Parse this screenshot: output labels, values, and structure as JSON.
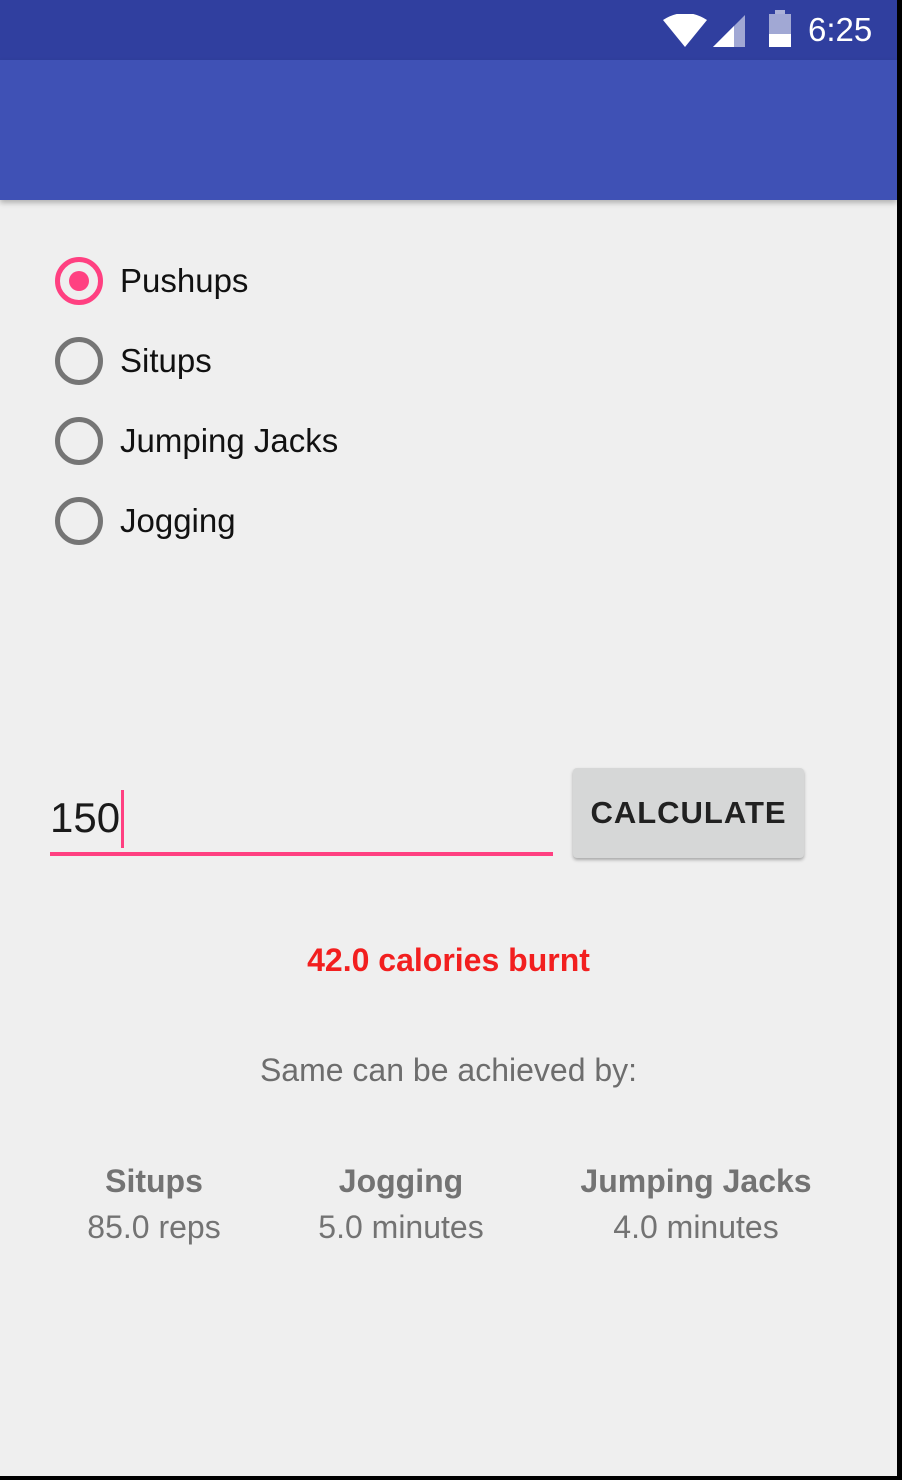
{
  "status_bar": {
    "time": "6:25",
    "icons": [
      "wifi-icon",
      "signal-icon",
      "battery-icon"
    ]
  },
  "colors": {
    "status_bar": "#303f9f",
    "app_bar": "#3f51b5",
    "accent": "#ff4081",
    "background": "#efefef",
    "result": "#f21f1f"
  },
  "exercises": {
    "selected": "Pushups",
    "options": [
      {
        "label": "Pushups",
        "checked": true
      },
      {
        "label": "Situps",
        "checked": false
      },
      {
        "label": "Jumping Jacks",
        "checked": false
      },
      {
        "label": "Jogging",
        "checked": false
      }
    ]
  },
  "input": {
    "value": "150"
  },
  "calculate_button": {
    "label": "CALCULATE"
  },
  "result": {
    "text": "42.0 calories burnt"
  },
  "equivalents": {
    "heading": "Same can be achieved by:",
    "items": [
      {
        "name": "Situps",
        "amount": "85.0 reps"
      },
      {
        "name": "Jogging",
        "amount": "5.0 minutes"
      },
      {
        "name": "Jumping Jacks",
        "amount": "4.0 minutes"
      }
    ]
  }
}
